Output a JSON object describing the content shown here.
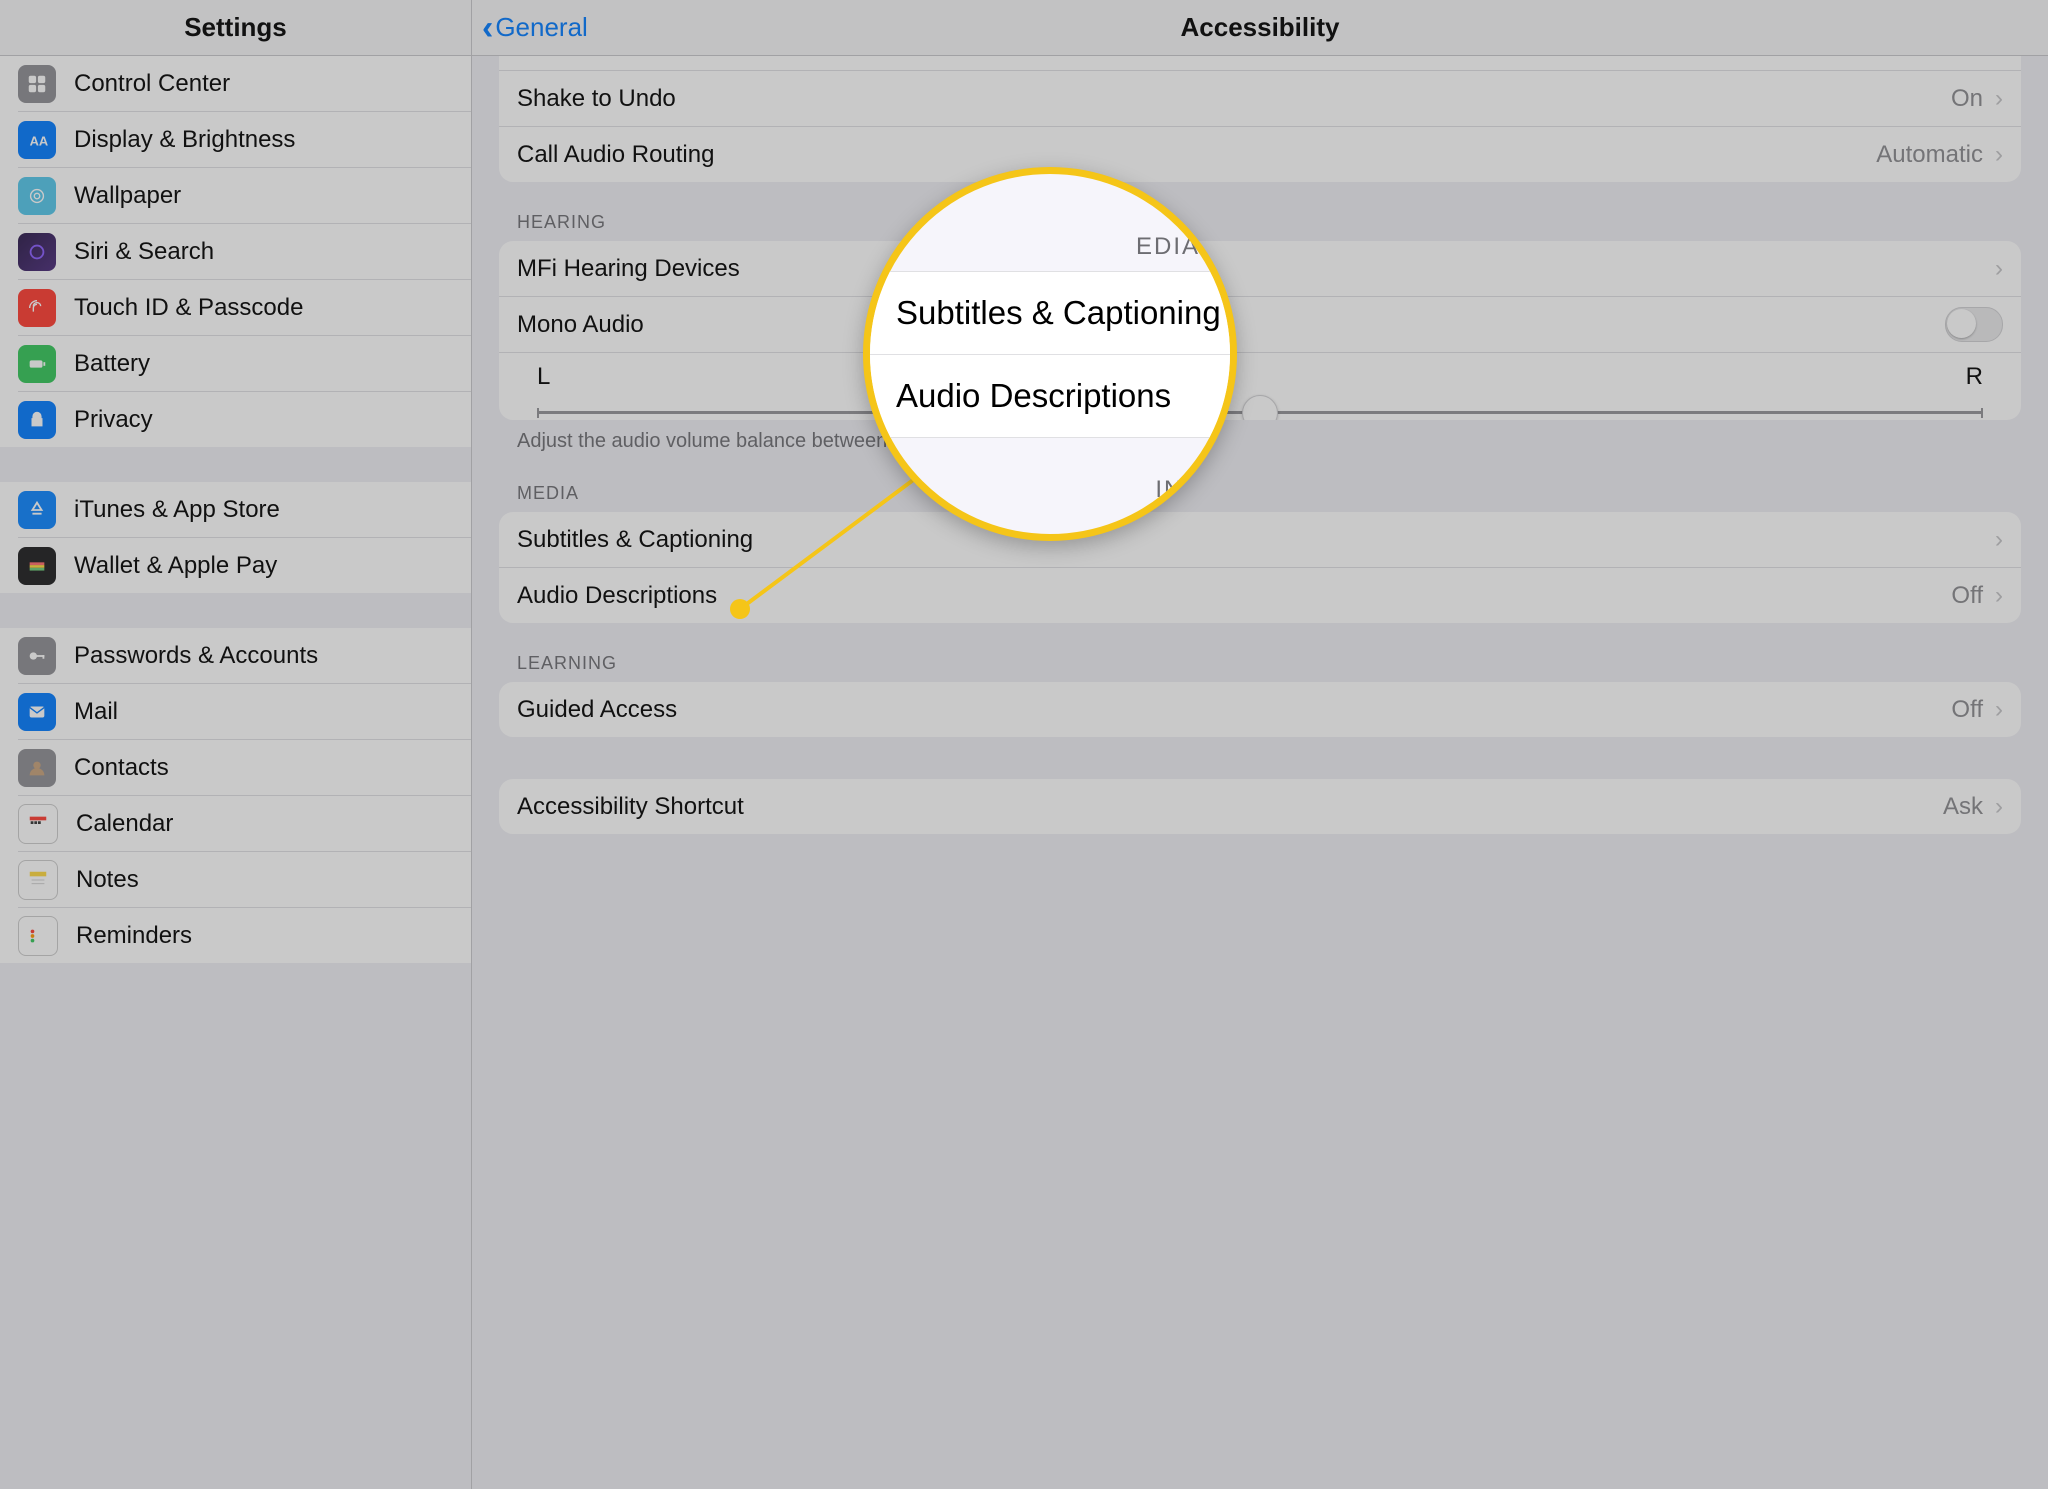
{
  "sidebar": {
    "title": "Settings",
    "groups": [
      {
        "items": [
          {
            "label": "Control Center",
            "icon": "control-center-icon",
            "bg": "bg-grey"
          },
          {
            "label": "Display & Brightness",
            "icon": "display-icon",
            "bg": "bg-blue"
          },
          {
            "label": "Wallpaper",
            "icon": "wallpaper-icon",
            "bg": "bg-cyan"
          },
          {
            "label": "Siri & Search",
            "icon": "siri-icon",
            "bg": "bg-purple-dark"
          },
          {
            "label": "Touch ID & Passcode",
            "icon": "touch-id-icon",
            "bg": "bg-red"
          },
          {
            "label": "Battery",
            "icon": "battery-icon",
            "bg": "bg-green"
          },
          {
            "label": "Privacy",
            "icon": "privacy-icon",
            "bg": "bg-blue2"
          }
        ]
      },
      {
        "items": [
          {
            "label": "iTunes & App Store",
            "icon": "appstore-icon",
            "bg": "bg-blue3"
          },
          {
            "label": "Wallet & Apple Pay",
            "icon": "wallet-icon",
            "bg": "bg-black"
          }
        ]
      },
      {
        "items": [
          {
            "label": "Passwords & Accounts",
            "icon": "key-icon",
            "bg": "bg-grey"
          },
          {
            "label": "Mail",
            "icon": "mail-icon",
            "bg": "bg-blue"
          },
          {
            "label": "Contacts",
            "icon": "contacts-icon",
            "bg": "bg-grey"
          },
          {
            "label": "Calendar",
            "icon": "calendar-icon",
            "bg": "bg-white"
          },
          {
            "label": "Notes",
            "icon": "notes-icon",
            "bg": "bg-white"
          },
          {
            "label": "Reminders",
            "icon": "reminders-icon",
            "bg": "bg-white"
          }
        ]
      }
    ]
  },
  "detail": {
    "back_label": "General",
    "title": "Accessibility",
    "sections": {
      "interaction": {
        "rows": [
          {
            "label": "Shake to Undo",
            "value": "On"
          },
          {
            "label": "Call Audio Routing",
            "value": "Automatic"
          }
        ]
      },
      "hearing": {
        "header": "HEARING",
        "rows": {
          "mfi": {
            "label": "MFi Hearing Devices"
          },
          "mono": {
            "label": "Mono Audio"
          },
          "balance_left": "L",
          "balance_right": "R",
          "balance_value": 0.5
        },
        "footer": "Adjust the audio volume balance between left and right channels."
      },
      "media": {
        "header": "MEDIA",
        "rows": [
          {
            "label": "Subtitles & Captioning"
          },
          {
            "label": "Audio Descriptions",
            "value": "Off"
          }
        ]
      },
      "learning": {
        "header": "LEARNING",
        "rows": [
          {
            "label": "Guided Access",
            "value": "Off"
          }
        ]
      },
      "shortcut": {
        "rows": [
          {
            "label": "Accessibility Shortcut",
            "value": "Ask"
          }
        ]
      }
    }
  },
  "magnifier": {
    "header_fragment": "EDIA",
    "row1": "Subtitles & Captioning",
    "row2": "Audio Descriptions",
    "footer_fragment": "ING"
  },
  "colors": {
    "accent_yellow": "#f5c518",
    "ios_blue": "#007aff"
  }
}
